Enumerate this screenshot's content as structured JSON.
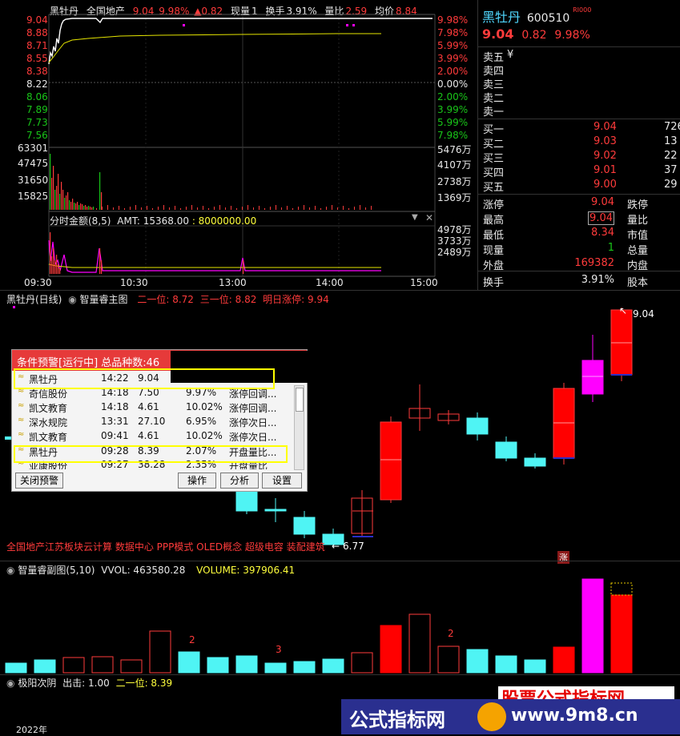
{
  "quote_header": {
    "name": "黑牡丹",
    "sector": "全国地产",
    "price": "9.04",
    "pct": "9.98%",
    "change": "▲0.82",
    "volume_label": "现量",
    "volume": "1",
    "turnover_label": "换手",
    "turnover": "3.91%",
    "ratio_label": "量比",
    "ratio": "2.59",
    "avg_label": "均价",
    "avg": "8.84"
  },
  "intraday": {
    "price_ticks": [
      "9.04",
      "8.88",
      "8.71",
      "8.55",
      "8.38",
      "8.22",
      "8.06",
      "7.89",
      "7.73",
      "7.56"
    ],
    "pct_ticks": [
      "9.98%",
      "7.98%",
      "5.99%",
      "3.99%",
      "2.00%",
      "0.00%",
      "2.00%",
      "3.99%",
      "5.99%",
      "7.98%"
    ],
    "vol_ticks": [
      "63301",
      "47475",
      "31650",
      "15825"
    ],
    "vol_right_ticks": [
      "5476万",
      "4107万",
      "2738万",
      "1369万"
    ],
    "amt_label": "分时金额(8,5)",
    "amt_text": "AMT: 15368.00",
    "amt_value": ": 8000000.00",
    "amt_right_ticks": [
      "4978万",
      "3733万",
      "2489万"
    ],
    "time_ticks": [
      "09:30",
      "10:30",
      "13:00",
      "14:00",
      "15:00"
    ]
  },
  "stock_panel": {
    "name": "黑牡丹",
    "code": "600510",
    "badge": "RI000",
    "price": "9.04",
    "change": "0.82",
    "pct": "9.98%",
    "sell": [
      {
        "label": "卖五",
        "price": "¥",
        "vol": ""
      },
      {
        "label": "卖四",
        "price": "",
        "vol": ""
      },
      {
        "label": "卖三",
        "price": "",
        "vol": ""
      },
      {
        "label": "卖二",
        "price": "",
        "vol": ""
      },
      {
        "label": "卖一",
        "price": "",
        "vol": ""
      }
    ],
    "buy": [
      {
        "label": "买一",
        "price": "9.04",
        "vol": "726"
      },
      {
        "label": "买二",
        "price": "9.03",
        "vol": "13"
      },
      {
        "label": "买三",
        "price": "9.02",
        "vol": "22"
      },
      {
        "label": "买四",
        "price": "9.01",
        "vol": "37"
      },
      {
        "label": "买五",
        "price": "9.00",
        "vol": "29"
      }
    ],
    "stats": [
      {
        "l1": "涨停",
        "v1": "9.04",
        "l2": "跌停"
      },
      {
        "l1": "最高",
        "v1": "9.04",
        "l2": "量比"
      },
      {
        "l1": "最低",
        "v1": "8.34",
        "l2": "市值"
      },
      {
        "l1": "现量",
        "v1": "1",
        "l2": "总量"
      },
      {
        "l1": "外盘",
        "v1": "169382",
        "l2": "内盘"
      },
      {
        "l1": "换手",
        "v1": "3.91%",
        "l2": "股本"
      }
    ]
  },
  "daily": {
    "title": "黑牡丹(日线)",
    "indicator": "智量睿主图",
    "line2": "二一位: 8.72",
    "line3": "三一位: 8.82",
    "next_limit": "明日涨停: 9.94",
    "high_label": "9.04",
    "low_label": "6.77",
    "concepts": "全国地产江苏板块云计算 数据中心 PPP模式 OLED概念 超级电容 装配建筑",
    "zhang_badge": "涨"
  },
  "alert": {
    "title": "条件预警[运行中] 总品种数:46",
    "rows": [
      {
        "name": "黑牡丹",
        "time": "14:22",
        "price": "9.04",
        "pct": "",
        "desc": ""
      },
      {
        "name": "奇信股份",
        "time": "14:18",
        "price": "7.50",
        "pct": "9.97%",
        "desc": "涨停回调..."
      },
      {
        "name": "凯文教育",
        "time": "14:18",
        "price": "4.61",
        "pct": "10.02%",
        "desc": "涨停回调..."
      },
      {
        "name": "深水规院",
        "time": "13:31",
        "price": "27.10",
        "pct": "6.95%",
        "desc": "涨停次日..."
      },
      {
        "name": "凯文教育",
        "time": "09:41",
        "price": "4.61",
        "pct": "10.02%",
        "desc": "涨停次日..."
      },
      {
        "name": "黑牡丹",
        "time": "09:28",
        "price": "8.39",
        "pct": "2.07%",
        "desc": "开盘量比..."
      },
      {
        "name": "亚康股份",
        "time": "09:27",
        "price": "38.28",
        "pct": "2.35%",
        "desc": "开盘量比"
      }
    ],
    "close_btn": "关闭预警",
    "op_btn": "操作",
    "analyze_btn": "分析",
    "settings_btn": "设置"
  },
  "sub_chart": {
    "title": "智量睿副图(5,10)",
    "vvol": "VVOL: 463580.28",
    "volume": "VOLUME: 397906.41",
    "annotations": [
      "2",
      "3",
      "2"
    ]
  },
  "bottom": {
    "title": "极阳次阴",
    "out_label": "出击: 1.00",
    "line2": "二一位: 8.39",
    "year": "2022年"
  },
  "watermark": {
    "site_top": "股票公式指标网",
    "site_cn": "公式指标网",
    "site_url": "www.9m8.cn"
  },
  "colors": {
    "up": "#ff0000",
    "down": "#4ff4f4",
    "magenta": "#ff00ff",
    "yellow": "#ffff3c",
    "alert_red": "#e63a3a"
  }
}
